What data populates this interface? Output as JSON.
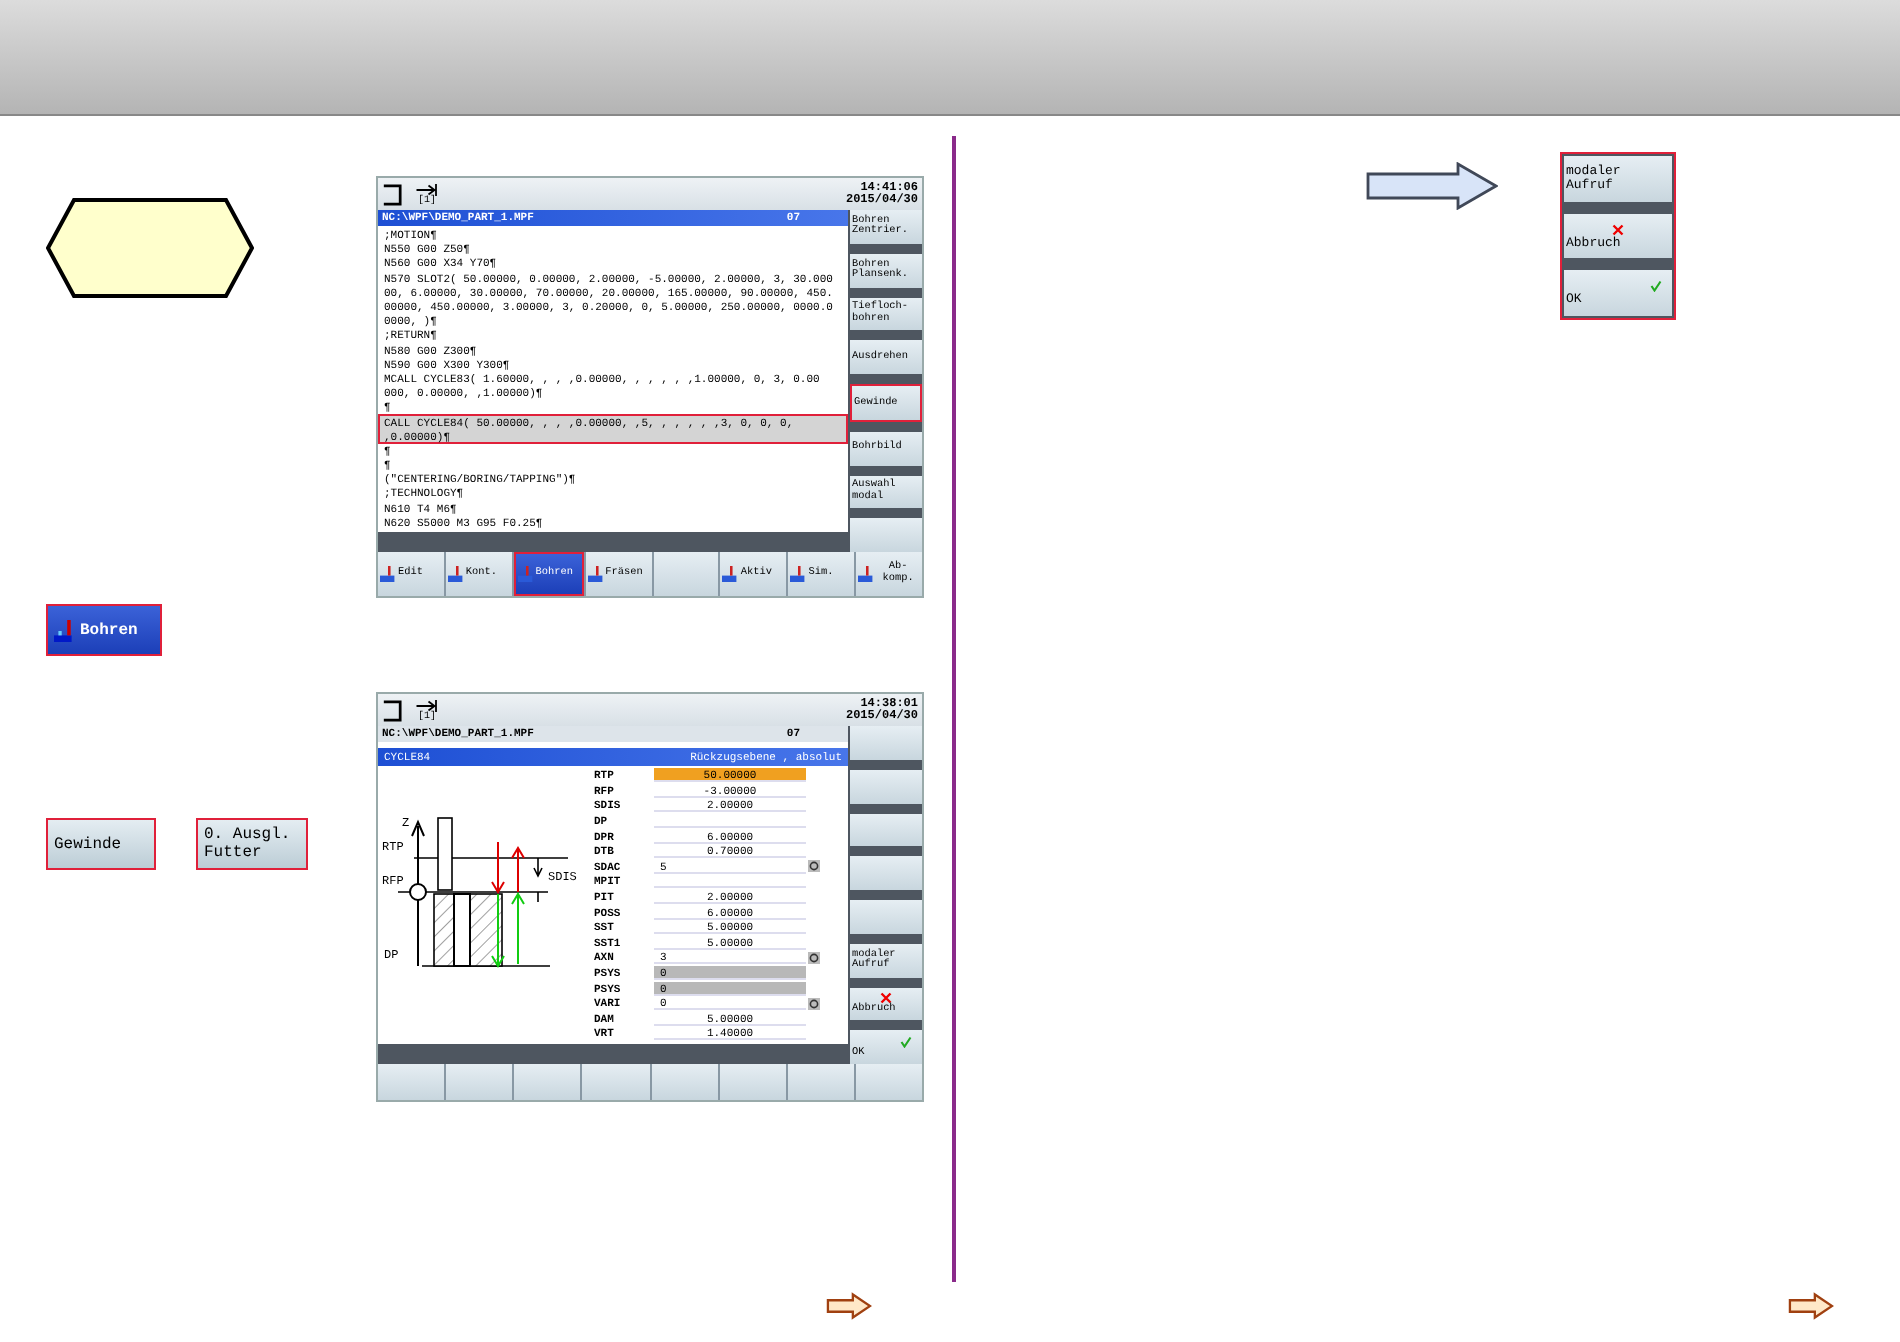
{
  "screens": [
    {
      "channel": "[1]",
      "time": "14:41:06",
      "date": "2015/04/30",
      "path": "NC:\\WPF\\DEMO_PART_1.MPF",
      "path_code": "07",
      "lines": [
        {
          "text": ";MOTION¶",
          "selected": false
        },
        {
          "text": "N550 G00 Z50¶",
          "selected": false
        },
        {
          "text": "N560 G00 X34 Y70¶",
          "selected": false
        },
        {
          "text": "N570 SLOT2( 50.00000, 0.00000, 2.00000, -5.00000, 2.00000, 3, 30.000",
          "selected": false
        },
        {
          "text": "00, 6.00000, 30.00000, 70.00000, 20.00000, 165.00000, 90.00000, 450.",
          "selected": false
        },
        {
          "text": "00000, 450.00000, 3.00000, 3, 0.20000, 0, 5.00000, 250.00000, 0000.0",
          "selected": false
        },
        {
          "text": "0000, )¶",
          "selected": false
        },
        {
          "text": ";RETURN¶",
          "selected": false
        },
        {
          "text": "N580 G00 Z300¶",
          "selected": false
        },
        {
          "text": "N590 G00 X300 Y300¶",
          "selected": false
        },
        {
          "text": "MCALL CYCLE83( 1.60000, , , ,0.00000, , , , , ,1.00000, 0, 3, 0.00",
          "selected": false
        },
        {
          "text": "000, 0.00000, ,1.00000)¶",
          "selected": false
        },
        {
          "text": "¶",
          "selected": false
        },
        {
          "text": "CALL CYCLE84( 50.00000, , , ,0.00000, ,5, , , , , ,3, 0, 0, 0,",
          "selected": true
        },
        {
          "text": ",0.00000)¶",
          "selected": true
        },
        {
          "text": "¶",
          "selected": false
        },
        {
          "text": "¶",
          "selected": false
        },
        {
          "text": "(\"CENTERING/BORING/TAPPING\")¶",
          "selected": false
        },
        {
          "text": ";TECHNOLOGY¶",
          "selected": false
        },
        {
          "text": "N610 T4 M6¶",
          "selected": false
        },
        {
          "text": "N620 S5000 M3 G95 F0.25¶",
          "selected": false
        }
      ],
      "side_keys": [
        {
          "label": "Bohren Zentrier.",
          "kind": "text",
          "selected": false
        },
        {
          "label": "Bohren Plansenk.",
          "kind": "text",
          "selected": false
        },
        {
          "label": "Tiefloch-bohren",
          "kind": "text",
          "selected": false
        },
        {
          "label": "Ausdrehen",
          "kind": "text",
          "selected": false
        },
        {
          "label": "Gewinde",
          "kind": "text",
          "selected": true
        },
        {
          "label": "Bohrbild",
          "kind": "text",
          "selected": false
        },
        {
          "label": "Auswahl modal",
          "kind": "text",
          "selected": false
        },
        {
          "kind": "text",
          "selected": false
        }
      ],
      "bottom_keys": [
        {
          "label": "Edit",
          "kind": "icon",
          "selected": false
        },
        {
          "label": "Kont.",
          "kind": "icon",
          "selected": false
        },
        {
          "label": "Bohren",
          "kind": "icon",
          "selected": true
        },
        {
          "label": "Fräsen",
          "kind": "icon",
          "selected": false
        },
        {
          "kind": "text",
          "selected": false
        },
        {
          "label": "Aktiv",
          "kind": "icon",
          "selected": false
        },
        {
          "label": "Sim.",
          "kind": "icon",
          "selected": false
        },
        {
          "label": "Ab-komp.",
          "kind": "icon",
          "selected": false
        }
      ]
    },
    {
      "channel": "[1]",
      "time": "14:38:01",
      "date": "2015/04/30",
      "path": "NC:\\WPF\\DEMO_PART_1.MPF",
      "path_code": "07",
      "cycle": {
        "title": "CYCLE84",
        "hint": "Rückzugsebene , absolut",
        "diagram_labels": [
          "Z",
          "RTP",
          "RFP",
          "SDIS",
          "DP"
        ],
        "params": [
          {
            "name": "RTP",
            "value": "50.00000",
            "kind": "active",
            "toggle": false
          },
          {
            "name": "RFP",
            "value": "-3.00000",
            "kind": "input",
            "toggle": false
          },
          {
            "name": "SDIS",
            "value": "2.00000",
            "kind": "input",
            "toggle": false
          },
          {
            "name": "DP",
            "kind": "input",
            "toggle": false
          },
          {
            "name": "DPR",
            "value": "6.00000",
            "kind": "input",
            "toggle": false
          },
          {
            "name": "DTB",
            "value": "0.70000",
            "kind": "input",
            "toggle": false
          },
          {
            "name": "SDAC",
            "value": "5",
            "kind": "choice",
            "toggle": true
          },
          {
            "name": "MPIT",
            "kind": "input",
            "toggle": false
          },
          {
            "name": "PIT",
            "value": "2.00000",
            "kind": "input",
            "toggle": false
          },
          {
            "name": "POSS",
            "value": "6.00000",
            "kind": "input",
            "toggle": false
          },
          {
            "name": "SST",
            "value": "5.00000",
            "kind": "input",
            "toggle": false
          },
          {
            "name": "SST1",
            "value": "5.00000",
            "kind": "input",
            "toggle": false
          },
          {
            "name": "AXN",
            "value": "3",
            "kind": "choice",
            "toggle": true
          },
          {
            "name": "PSYS",
            "value": "0",
            "kind": "fixed",
            "toggle": false
          },
          {
            "name": "PSYS",
            "value": "0",
            "kind": "fixed",
            "toggle": false
          },
          {
            "name": "VARI",
            "value": "0",
            "kind": "choice",
            "toggle": true
          },
          {
            "name": "DAM",
            "value": "5.00000",
            "kind": "input",
            "toggle": false
          },
          {
            "name": "VRT",
            "value": "1.40000",
            "kind": "input",
            "toggle": false
          }
        ]
      },
      "side_keys": [
        {
          "kind": "text",
          "selected": false
        },
        {
          "kind": "text",
          "selected": false
        },
        {
          "kind": "text",
          "selected": false
        },
        {
          "kind": "text",
          "selected": false
        },
        {
          "kind": "text",
          "selected": false
        },
        {
          "label": "modaler Aufruf",
          "kind": "text",
          "selected": false
        },
        {
          "label": "Abbruch",
          "kind": "cancel",
          "selected": false
        },
        {
          "label": "OK",
          "kind": "ok",
          "selected": false
        }
      ],
      "bottom_keys": [
        {
          "kind": "text",
          "selected": false
        },
        {
          "kind": "text",
          "selected": false
        },
        {
          "kind": "text",
          "selected": false
        },
        {
          "kind": "text",
          "selected": false
        },
        {
          "kind": "text",
          "selected": false
        },
        {
          "kind": "text",
          "selected": false
        },
        {
          "kind": "text",
          "selected": false
        },
        {
          "kind": "text",
          "selected": false
        }
      ]
    }
  ],
  "left_panel": {
    "mode_key": {
      "label": "Bohren",
      "kind": "icon"
    },
    "option_keys": [
      {
        "label": "Gewinde"
      },
      {
        "label": "0. Ausgl. Futter"
      }
    ]
  },
  "right_panel": {
    "keys": [
      {
        "label": "modaler Aufruf",
        "kind": "text"
      },
      {
        "label": "Abbruch",
        "kind": "cancel"
      },
      {
        "label": "OK",
        "kind": "ok"
      }
    ]
  }
}
